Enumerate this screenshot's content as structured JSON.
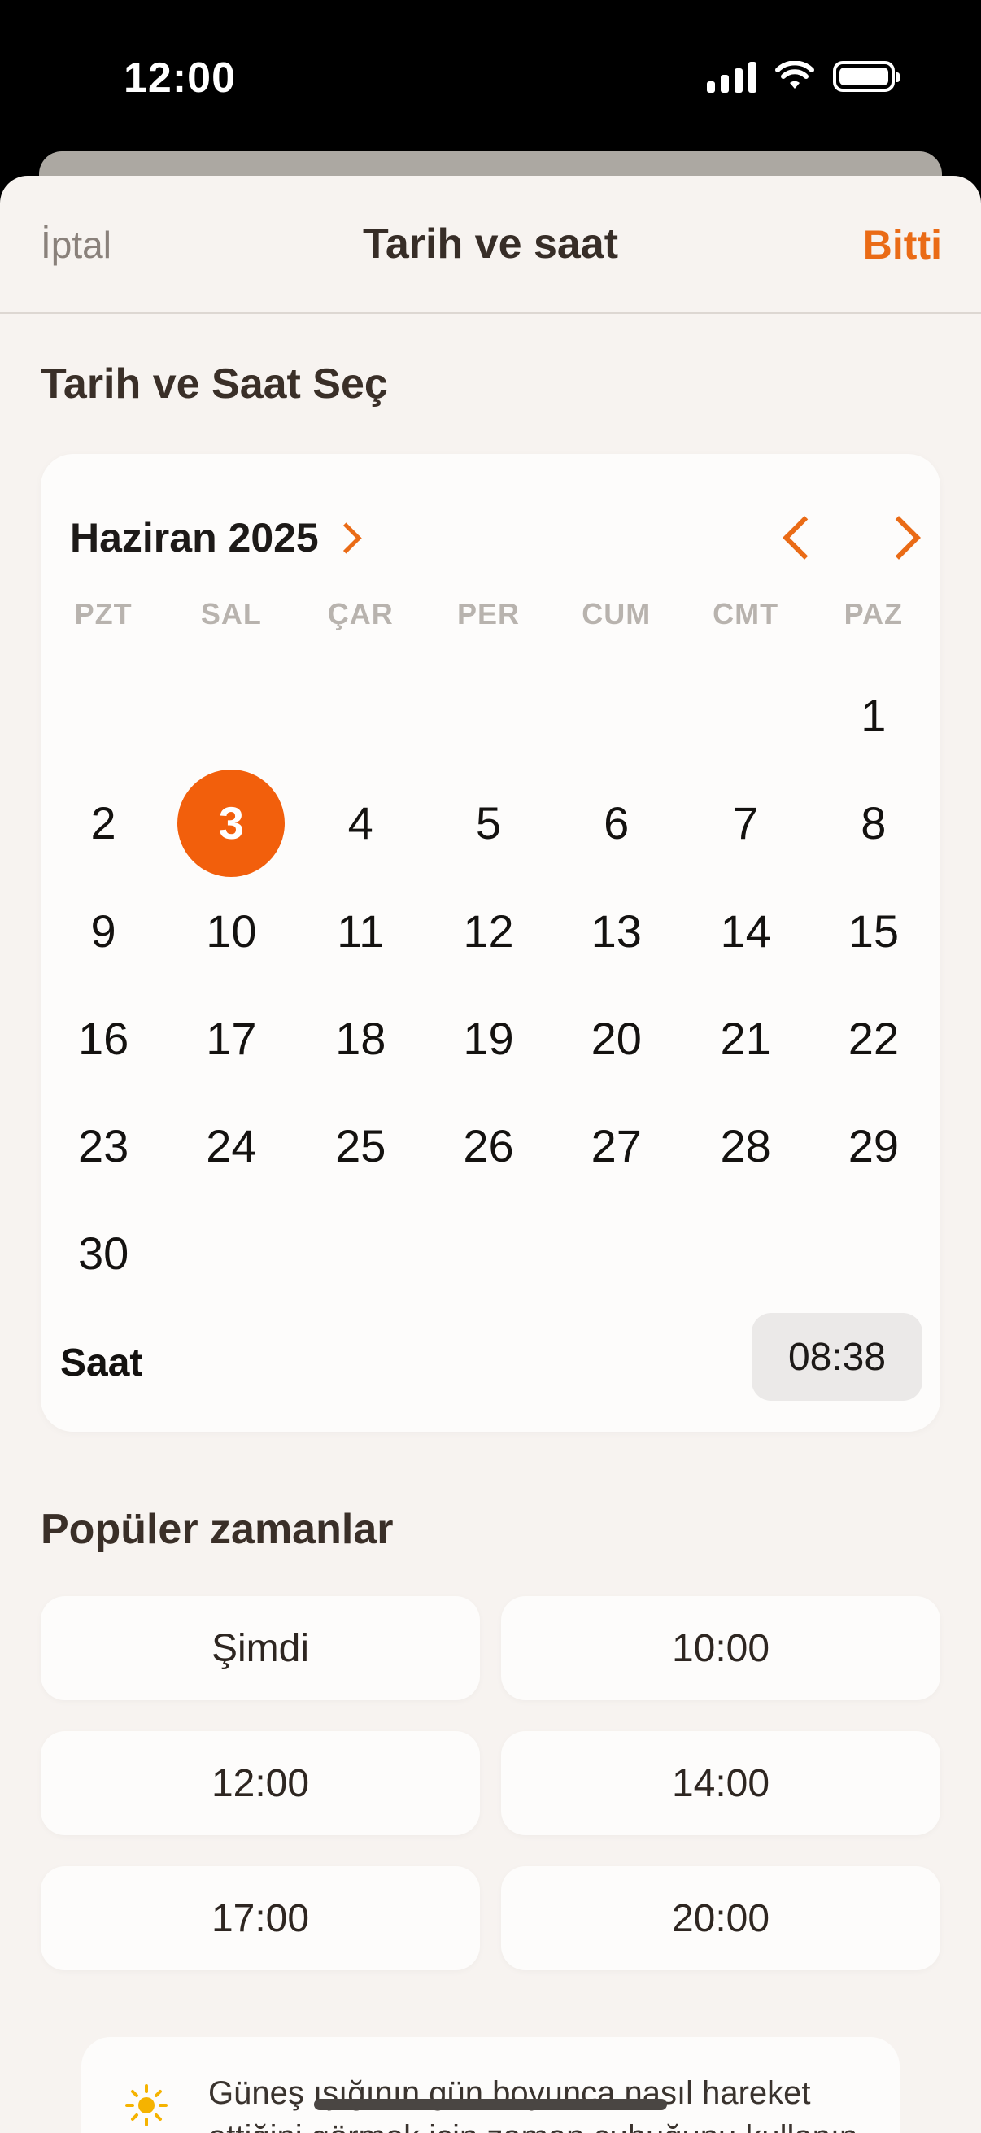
{
  "status_bar": {
    "time": "12:00"
  },
  "nav": {
    "cancel": "İptal",
    "title": "Tarih ve saat",
    "done": "Bitti"
  },
  "section_title": "Tarih ve Saat Seç",
  "calendar": {
    "month_label": "Haziran 2025",
    "weekdays": [
      "PZT",
      "SAL",
      "ÇAR",
      "PER",
      "CUM",
      "CMT",
      "PAZ"
    ],
    "first_weekday_index": 6,
    "days_in_month": 30,
    "selected_day": 3
  },
  "time": {
    "label": "Saat",
    "value": "08:38"
  },
  "popular": {
    "title": "Popüler zamanlar",
    "items": [
      "Şimdi",
      "10:00",
      "12:00",
      "14:00",
      "17:00",
      "20:00"
    ]
  },
  "tip": {
    "text": "Güneş ışığının gün boyunca nasıl hareket ettiğini görmek için zaman çubuğunu kullanın."
  },
  "colors": {
    "accent": "#ea6b16",
    "selected": "#f25f0c",
    "background": "#f7f3f0"
  }
}
